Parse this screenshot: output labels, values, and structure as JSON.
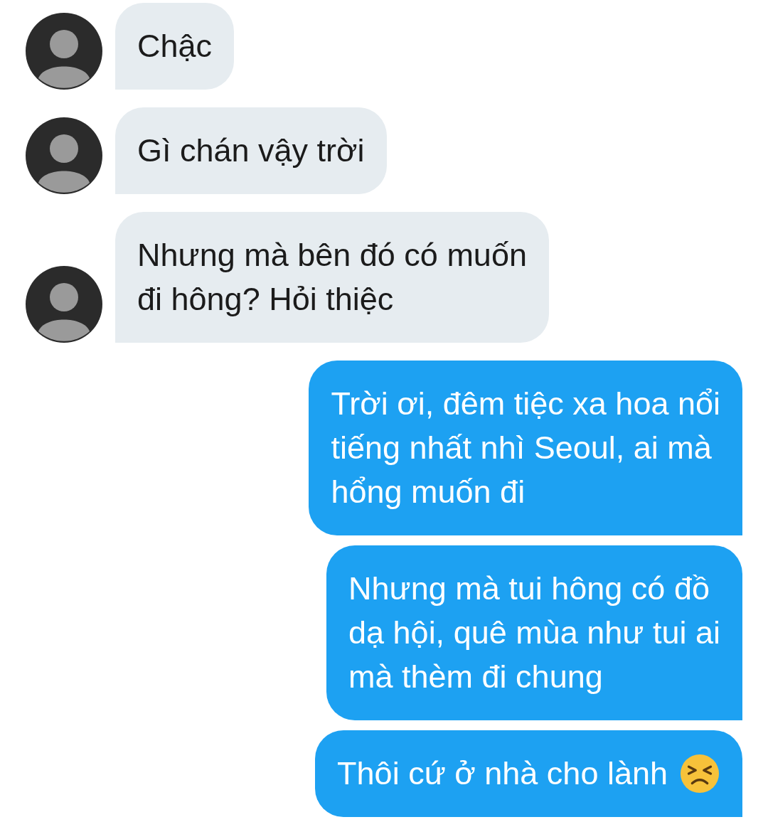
{
  "messages": [
    {
      "kind": "received",
      "lines": [
        "Chậc"
      ]
    },
    {
      "kind": "received",
      "lines": [
        "Gì chán vậy trời"
      ]
    },
    {
      "kind": "received",
      "lines": [
        "Nhưng mà bên đó có muốn",
        "đi hông? Hỏi thiệc"
      ]
    },
    {
      "kind": "sent",
      "lines": [
        "Trời ơi, đêm tiệc xa hoa nổi",
        "tiếng nhất nhì Seoul, ai mà",
        "hổng muốn đi"
      ]
    },
    {
      "kind": "sent",
      "lines": [
        "Nhưng mà tui hông có đồ",
        "dạ hội, quê mùa như tui ai",
        "mà thèm đi chung"
      ]
    },
    {
      "kind": "sent",
      "lines": [
        "Thôi cứ ở nhà cho lành"
      ],
      "emoji": true
    }
  ]
}
